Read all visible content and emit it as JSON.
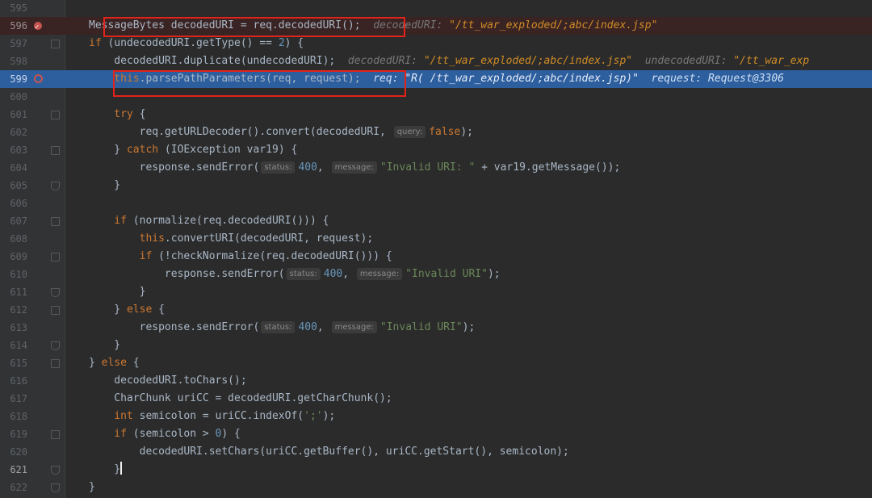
{
  "lines": [
    {
      "n": "595",
      "kind": "plain",
      "segs": []
    },
    {
      "n": "596",
      "kind": "bp",
      "segs": [
        {
          "t": "MessageBytes decodedURI = req.decodedURI();",
          "c": ""
        },
        {
          "t": "  decodedURI: ",
          "c": "inline-key"
        },
        {
          "t": "\"/tt_war_exploded/;abc/index.jsp\"",
          "c": "inline-val"
        }
      ]
    },
    {
      "n": "597",
      "kind": "plain",
      "segs": [
        {
          "t": "if",
          "c": "kw"
        },
        {
          "t": " (undecodedURI.getType() == ",
          "c": ""
        },
        {
          "t": "2",
          "c": "num-lit"
        },
        {
          "t": ") {",
          "c": ""
        }
      ]
    },
    {
      "n": "598",
      "kind": "plain",
      "segs": [
        {
          "t": "    decodedURI.duplicate(undecodedURI);",
          "c": ""
        },
        {
          "t": "  decodedURI: ",
          "c": "inline-key"
        },
        {
          "t": "\"/tt_war_exploded/;abc/index.jsp\"",
          "c": "inline-val"
        },
        {
          "t": "  undecodedURI: ",
          "c": "inline-key"
        },
        {
          "t": "\"/tt_war_exp",
          "c": "inline-val"
        }
      ]
    },
    {
      "n": "599",
      "kind": "exec",
      "segs": [
        {
          "t": "    this",
          "c": "kw"
        },
        {
          "t": ".parsePathParameters(req, request);",
          "c": ""
        },
        {
          "t": "  req: ",
          "c": "inline-key"
        },
        {
          "t": "\"R( /tt_war_exploded/;abc/index.jsp)\"",
          "c": "inline-val"
        },
        {
          "t": "  request: Request@3306",
          "c": "inline-key"
        }
      ]
    },
    {
      "n": "600",
      "kind": "plain",
      "segs": []
    },
    {
      "n": "601",
      "kind": "plain",
      "segs": [
        {
          "t": "    try",
          "c": "kw"
        },
        {
          "t": " {",
          "c": ""
        }
      ]
    },
    {
      "n": "602",
      "kind": "plain",
      "segs": [
        {
          "t": "        req.getURLDecoder().convert(decodedURI, ",
          "c": ""
        },
        {
          "t": "query:",
          "c": "hint"
        },
        {
          "t": "false",
          "c": "kw"
        },
        {
          "t": ");",
          "c": ""
        }
      ]
    },
    {
      "n": "603",
      "kind": "plain",
      "segs": [
        {
          "t": "    } ",
          "c": ""
        },
        {
          "t": "catch",
          "c": "kw"
        },
        {
          "t": " (IOException var19) {",
          "c": ""
        }
      ]
    },
    {
      "n": "604",
      "kind": "plain",
      "segs": [
        {
          "t": "        response.sendError(",
          "c": ""
        },
        {
          "t": "status:",
          "c": "hint"
        },
        {
          "t": "400",
          "c": "num-lit"
        },
        {
          "t": ", ",
          "c": ""
        },
        {
          "t": "message:",
          "c": "hint"
        },
        {
          "t": "\"Invalid URI: \"",
          "c": "str"
        },
        {
          "t": " + var19.getMessage());",
          "c": ""
        }
      ]
    },
    {
      "n": "605",
      "kind": "plain",
      "segs": [
        {
          "t": "    }",
          "c": ""
        }
      ]
    },
    {
      "n": "606",
      "kind": "plain",
      "segs": []
    },
    {
      "n": "607",
      "kind": "plain",
      "segs": [
        {
          "t": "    if",
          "c": "kw"
        },
        {
          "t": " (normalize(req.decodedURI())) {",
          "c": ""
        }
      ]
    },
    {
      "n": "608",
      "kind": "plain",
      "segs": [
        {
          "t": "        this",
          "c": "kw"
        },
        {
          "t": ".convertURI(decodedURI, request);",
          "c": ""
        }
      ]
    },
    {
      "n": "609",
      "kind": "plain",
      "segs": [
        {
          "t": "        if",
          "c": "kw"
        },
        {
          "t": " (!checkNormalize(req.decodedURI())) {",
          "c": ""
        }
      ]
    },
    {
      "n": "610",
      "kind": "plain",
      "segs": [
        {
          "t": "            response.sendError(",
          "c": ""
        },
        {
          "t": "status:",
          "c": "hint"
        },
        {
          "t": "400",
          "c": "num-lit"
        },
        {
          "t": ", ",
          "c": ""
        },
        {
          "t": "message:",
          "c": "hint"
        },
        {
          "t": "\"Invalid URI\"",
          "c": "str"
        },
        {
          "t": ");",
          "c": ""
        }
      ]
    },
    {
      "n": "611",
      "kind": "plain",
      "segs": [
        {
          "t": "        }",
          "c": ""
        }
      ]
    },
    {
      "n": "612",
      "kind": "plain",
      "segs": [
        {
          "t": "    } ",
          "c": ""
        },
        {
          "t": "else",
          "c": "kw"
        },
        {
          "t": " {",
          "c": ""
        }
      ]
    },
    {
      "n": "613",
      "kind": "plain",
      "segs": [
        {
          "t": "        response.sendError(",
          "c": ""
        },
        {
          "t": "status:",
          "c": "hint"
        },
        {
          "t": "400",
          "c": "num-lit"
        },
        {
          "t": ", ",
          "c": ""
        },
        {
          "t": "message:",
          "c": "hint"
        },
        {
          "t": "\"Invalid URI\"",
          "c": "str"
        },
        {
          "t": ");",
          "c": ""
        }
      ]
    },
    {
      "n": "614",
      "kind": "plain",
      "segs": [
        {
          "t": "    }",
          "c": ""
        }
      ]
    },
    {
      "n": "615",
      "kind": "plain",
      "segs": [
        {
          "t": "} ",
          "c": ""
        },
        {
          "t": "else",
          "c": "kw"
        },
        {
          "t": " {",
          "c": ""
        }
      ]
    },
    {
      "n": "616",
      "kind": "plain",
      "segs": [
        {
          "t": "    decodedURI.toChars();",
          "c": ""
        }
      ]
    },
    {
      "n": "617",
      "kind": "plain",
      "segs": [
        {
          "t": "    CharChunk uriCC = decodedURI.getCharChunk();",
          "c": ""
        }
      ]
    },
    {
      "n": "618",
      "kind": "plain",
      "segs": [
        {
          "t": "    int",
          "c": "kw"
        },
        {
          "t": " semicolon = uriCC.indexOf(",
          "c": ""
        },
        {
          "t": "';'",
          "c": "str"
        },
        {
          "t": ");",
          "c": ""
        }
      ]
    },
    {
      "n": "619",
      "kind": "plain",
      "segs": [
        {
          "t": "    if",
          "c": "kw"
        },
        {
          "t": " (semicolon > ",
          "c": ""
        },
        {
          "t": "0",
          "c": "num-lit"
        },
        {
          "t": ") {",
          "c": ""
        }
      ]
    },
    {
      "n": "620",
      "kind": "plain",
      "segs": [
        {
          "t": "        decodedURI.setChars(uriCC.getBuffer(), uriCC.getStart(), semicolon);",
          "c": ""
        }
      ]
    },
    {
      "n": "621",
      "kind": "current",
      "segs": [
        {
          "t": "    }",
          "c": "caret"
        }
      ]
    },
    {
      "n": "622",
      "kind": "plain",
      "segs": [
        {
          "t": "}",
          "c": ""
        }
      ]
    }
  ],
  "colors": {
    "background": "#2b2b2b",
    "execution_line": "#2d5e9e",
    "breakpoint_line": "#3a2323",
    "highlight_box": "#e2231a"
  }
}
